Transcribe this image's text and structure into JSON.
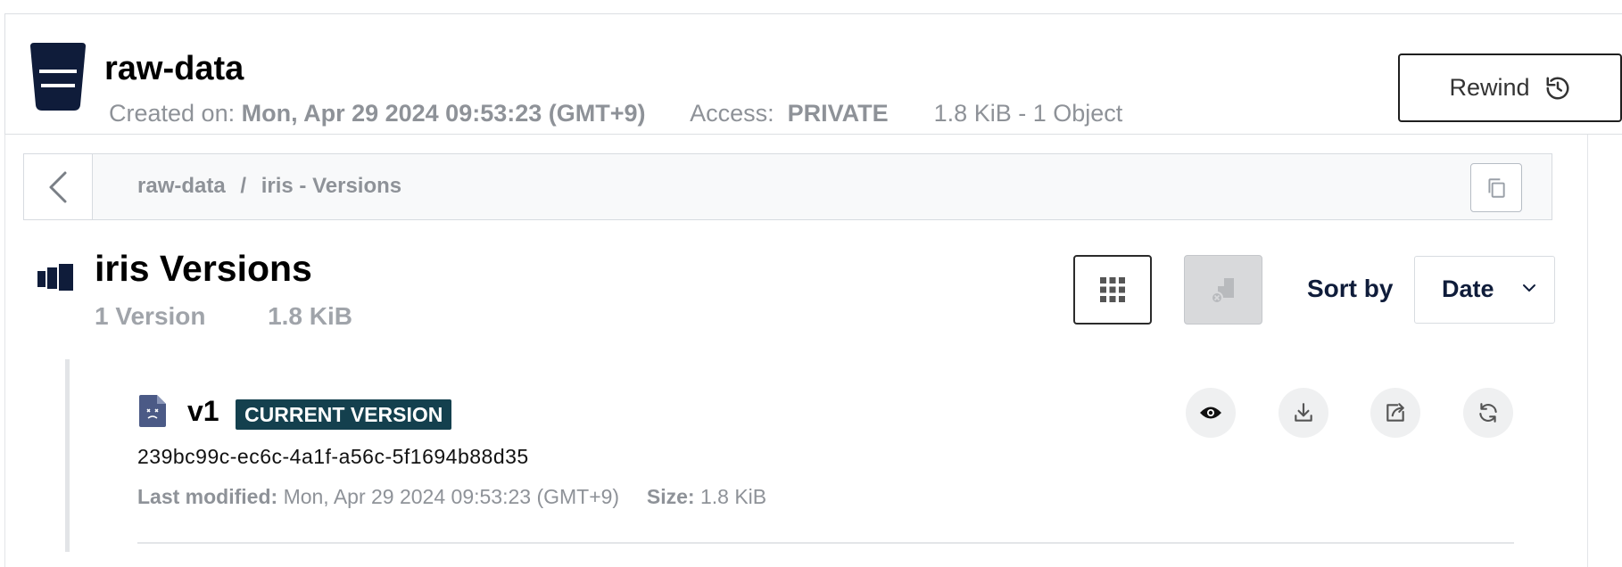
{
  "header": {
    "bucket_name": "raw-data",
    "created_on_label": "Created on:",
    "created_on_value": "Mon, Apr 29 2024 09:53:23 (GMT+9)",
    "access_label": "Access:",
    "access_value": "PRIVATE",
    "usage_summary": "1.8 KiB - 1 Object",
    "rewind_label": "Rewind",
    "bucket_icon": "bucket-icon",
    "rewind_icon": "history-icon"
  },
  "breadcrumb": {
    "root": "raw-data",
    "separator": "/",
    "current": "iris - Versions",
    "back_icon": "chevron-left-icon",
    "copy_icon": "copy-icon"
  },
  "versions_panel": {
    "title": "iris Versions",
    "version_count": "1 Version",
    "total_size": "1.8 KiB",
    "sort_by_label": "Sort by",
    "sort_value": "Date",
    "grid_icon": "grid-icon",
    "disabled_icon": "delete-versions-icon"
  },
  "versions": [
    {
      "label": "v1",
      "badge": "CURRENT VERSION",
      "version_id": "239bc99c-ec6c-4a1f-a56c-5f1694b88d35",
      "last_modified_label": "Last modified:",
      "last_modified_value": "Mon, Apr 29 2024 09:53:23 (GMT+9)",
      "size_label": "Size:",
      "size_value": "1.8 KiB",
      "actions": [
        "eye-icon",
        "download-icon",
        "share-icon",
        "restore-icon"
      ]
    }
  ],
  "colors": {
    "navy": "#0f1c3a",
    "badge_bg": "#14404e",
    "muted_text": "#8e9298"
  }
}
